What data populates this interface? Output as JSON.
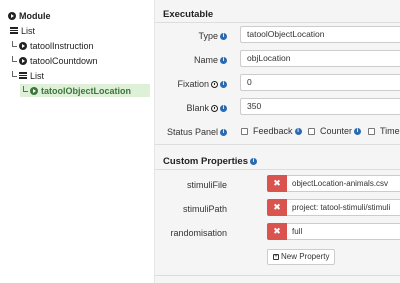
{
  "tree": {
    "root": "Module",
    "items": [
      {
        "label": "List"
      },
      {
        "label": "tatoolInstruction"
      },
      {
        "label": "tatoolCountdown"
      },
      {
        "label": "List"
      },
      {
        "label": "tatoolObjectLocation"
      }
    ]
  },
  "executable": {
    "title": "Executable",
    "type_label": "Type",
    "type_value": "tatoolObjectLocation",
    "name_label": "Name",
    "name_value": "objLocation",
    "fixation_label": "Fixation",
    "fixation_value": "0",
    "blank_label": "Blank",
    "blank_value": "350",
    "status_label": "Status Panel",
    "checkboxes": [
      "Feedback",
      "Counter",
      "Timer"
    ]
  },
  "custom": {
    "title": "Custom Properties",
    "properties": [
      {
        "label": "stimuliFile",
        "value": "objectLocation-animals.csv"
      },
      {
        "label": "stimuliPath",
        "value": "project: tatool-stimuli/stimuli"
      },
      {
        "label": "randomisation",
        "value": "full"
      }
    ],
    "delete_symbol": "✖",
    "new_button": "New Property"
  },
  "colors": {
    "selected_bg": "#dff0d8",
    "selected_text": "#3c763d",
    "info_blue": "#2a6ab0",
    "delete_red": "#d9534f"
  }
}
